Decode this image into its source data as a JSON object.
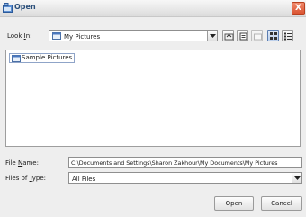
{
  "window": {
    "title": "Open",
    "close_glyph": "X"
  },
  "lookin": {
    "label": "Look In:",
    "value": "My Pictures",
    "toolbar_icons": [
      "up-folder-icon",
      "home-icon",
      "new-folder-icon",
      "list-view-icon",
      "details-view-icon"
    ]
  },
  "files": [
    {
      "name": "Sample Pictures",
      "icon": "folder-icon"
    }
  ],
  "filename": {
    "label": "File Name:",
    "value": "C:\\Documents and Settings\\Sharon Zakhour\\My Documents\\My Pictures"
  },
  "filetype": {
    "label": "Files of Type:",
    "value": "All Files"
  },
  "buttons": {
    "open": "Open",
    "cancel": "Cancel"
  }
}
